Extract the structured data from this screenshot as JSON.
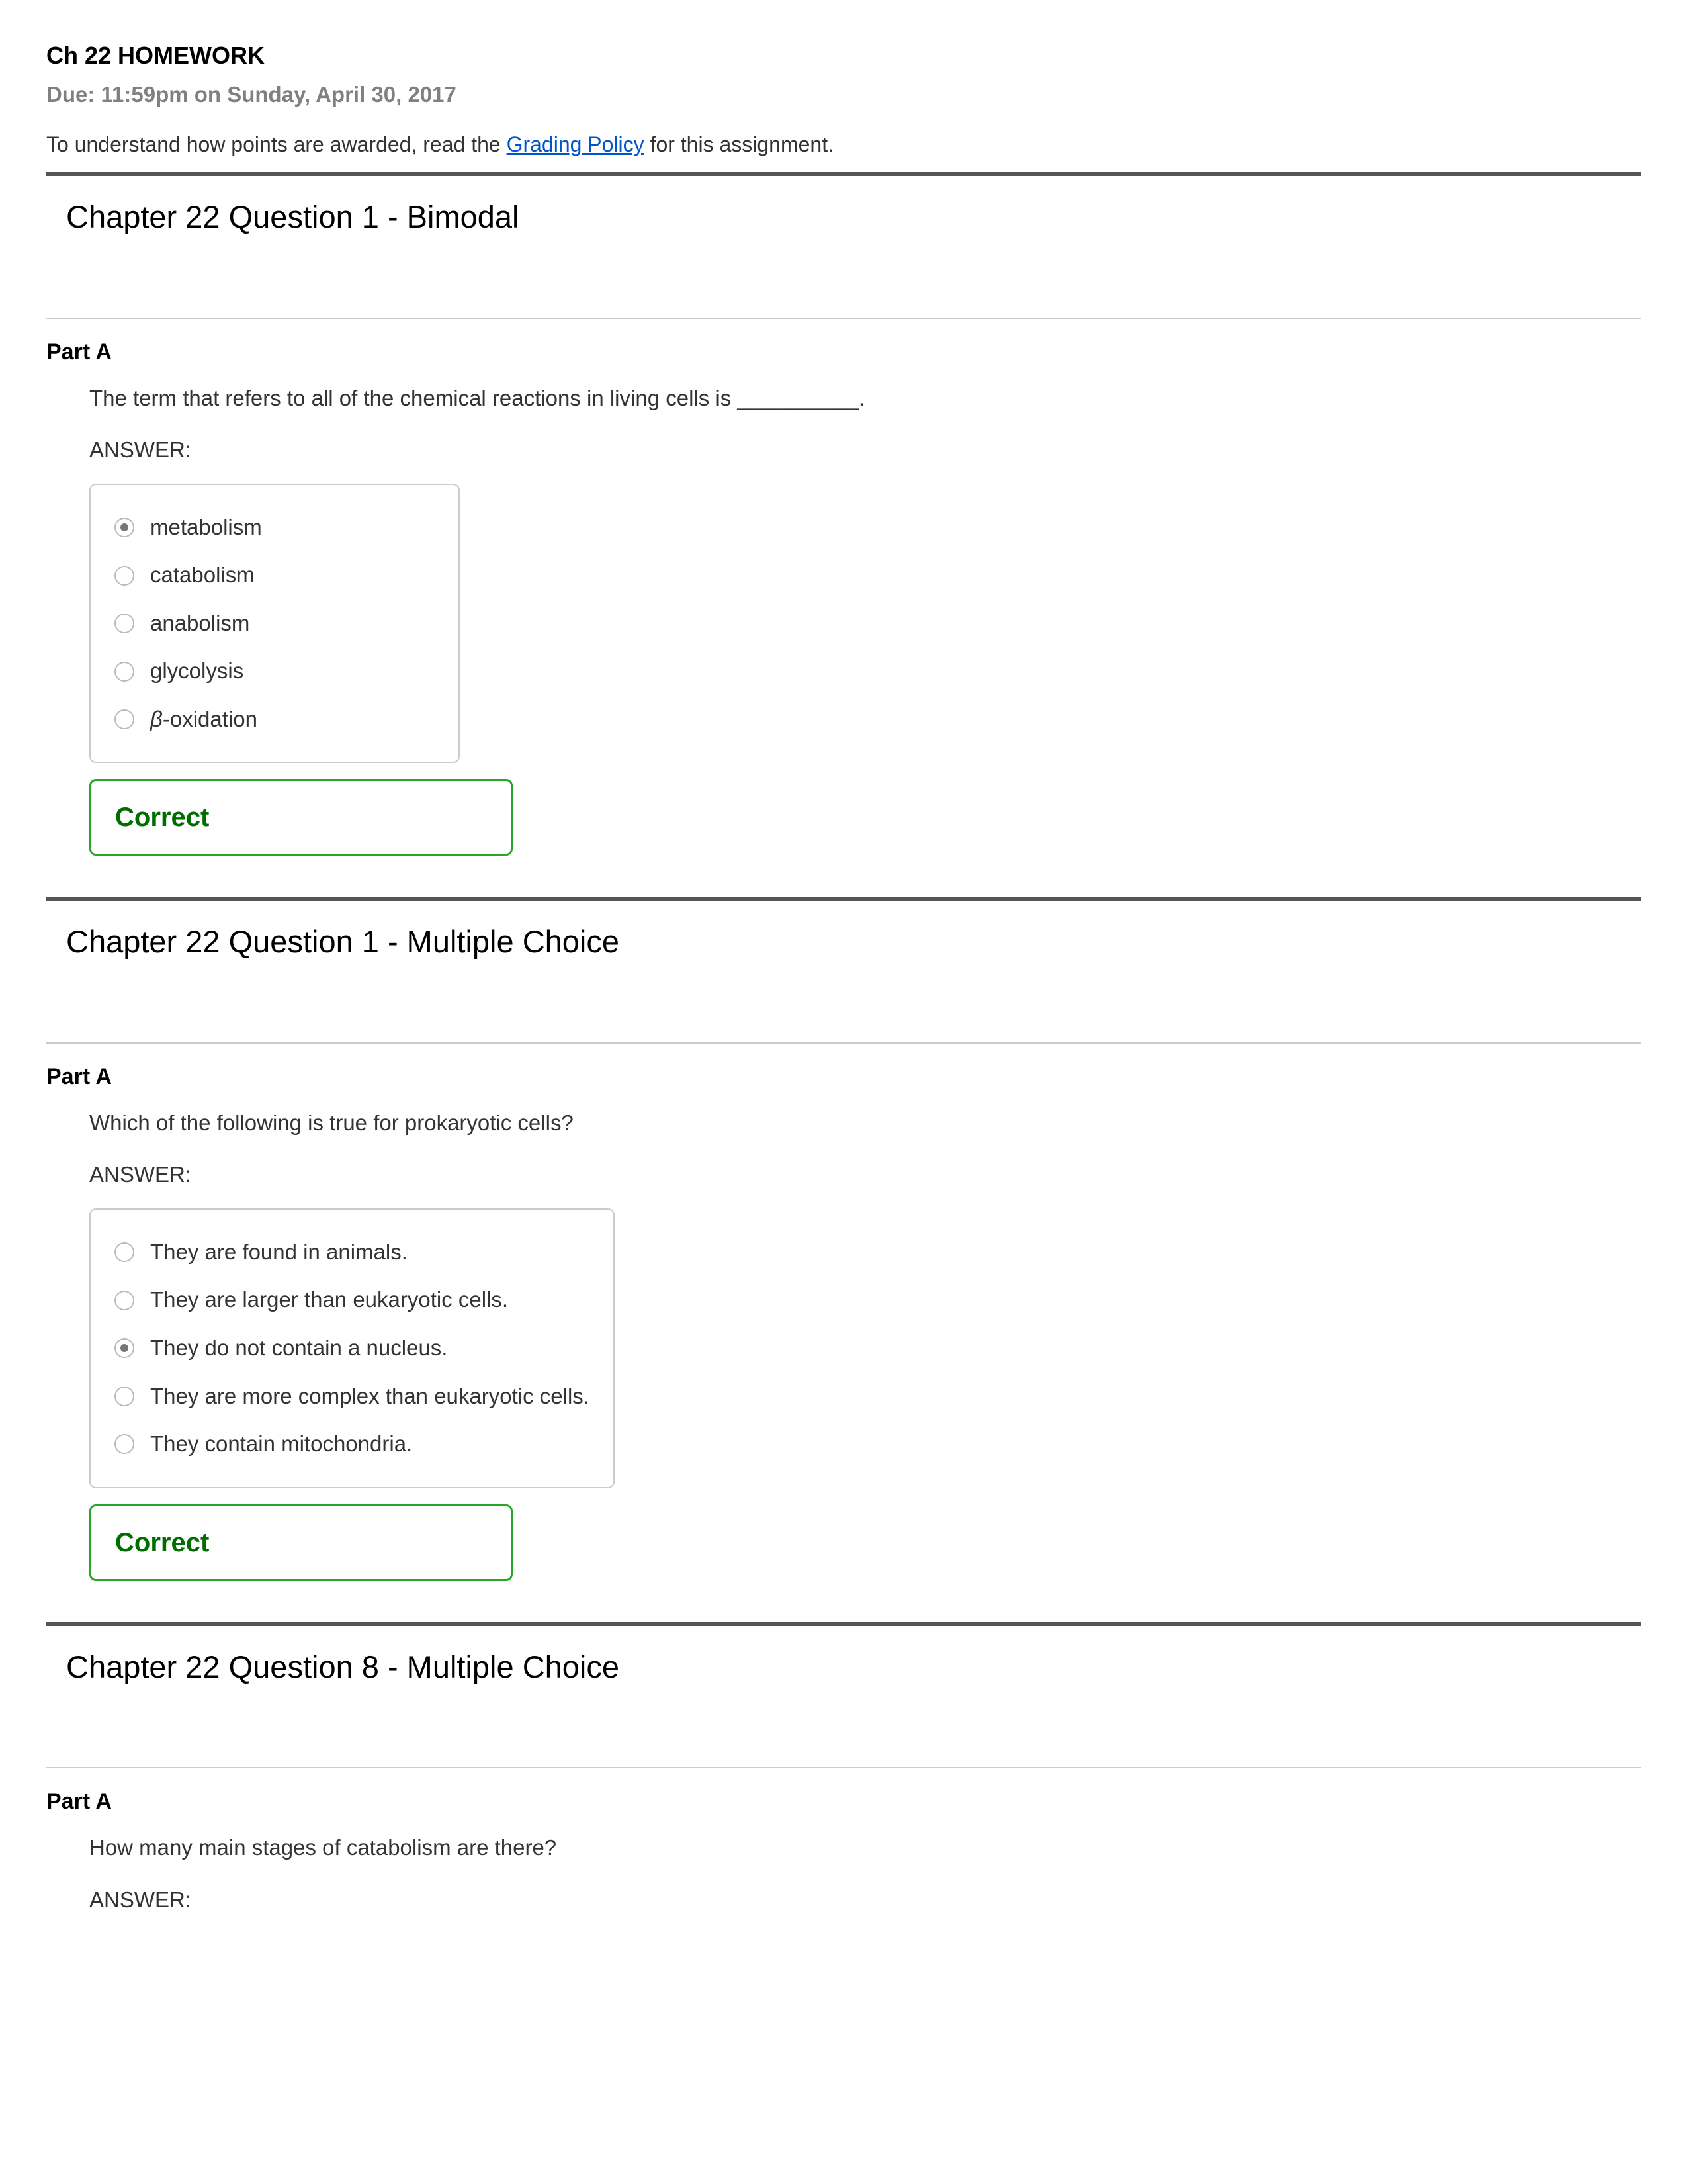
{
  "header": {
    "title": "Ch 22 HOMEWORK",
    "due": "Due: 11:59pm on Sunday, April 30, 2017",
    "policy_prefix": "To understand how points are awarded, read the ",
    "policy_link": "Grading Policy",
    "policy_suffix": " for this assignment."
  },
  "q1": {
    "title": "Chapter 22 Question 1 - Bimodal",
    "part_label": "Part A",
    "prompt": "The term that refers to all of the chemical reactions in living cells is __________.",
    "answer_label": "ANSWER:",
    "choices": [
      {
        "label": "metabolism",
        "selected": true
      },
      {
        "label": "catabolism",
        "selected": false
      },
      {
        "label": "anabolism",
        "selected": false
      },
      {
        "label": "glycolysis",
        "selected": false
      },
      {
        "label_html": "<span class='italic'>β</span>-oxidation",
        "label": "β-oxidation",
        "selected": false
      }
    ],
    "feedback": "Correct"
  },
  "q2": {
    "title": "Chapter 22 Question 1 - Multiple Choice",
    "part_label": "Part A",
    "prompt": "Which of the following is true for prokaryotic cells?",
    "answer_label": "ANSWER:",
    "choices": [
      {
        "label": "They are found in animals.",
        "selected": false
      },
      {
        "label": "They are larger than eukaryotic cells.",
        "selected": false
      },
      {
        "label": "They do not contain a nucleus.",
        "selected": true
      },
      {
        "label": "They are more complex than eukaryotic cells.",
        "selected": false
      },
      {
        "label": "They contain mitochondria.",
        "selected": false
      }
    ],
    "feedback": "Correct"
  },
  "q3": {
    "title": "Chapter 22 Question 8 - Multiple Choice",
    "part_label": "Part A",
    "prompt": "How many main stages of catabolism are there?",
    "answer_label": "ANSWER:"
  }
}
